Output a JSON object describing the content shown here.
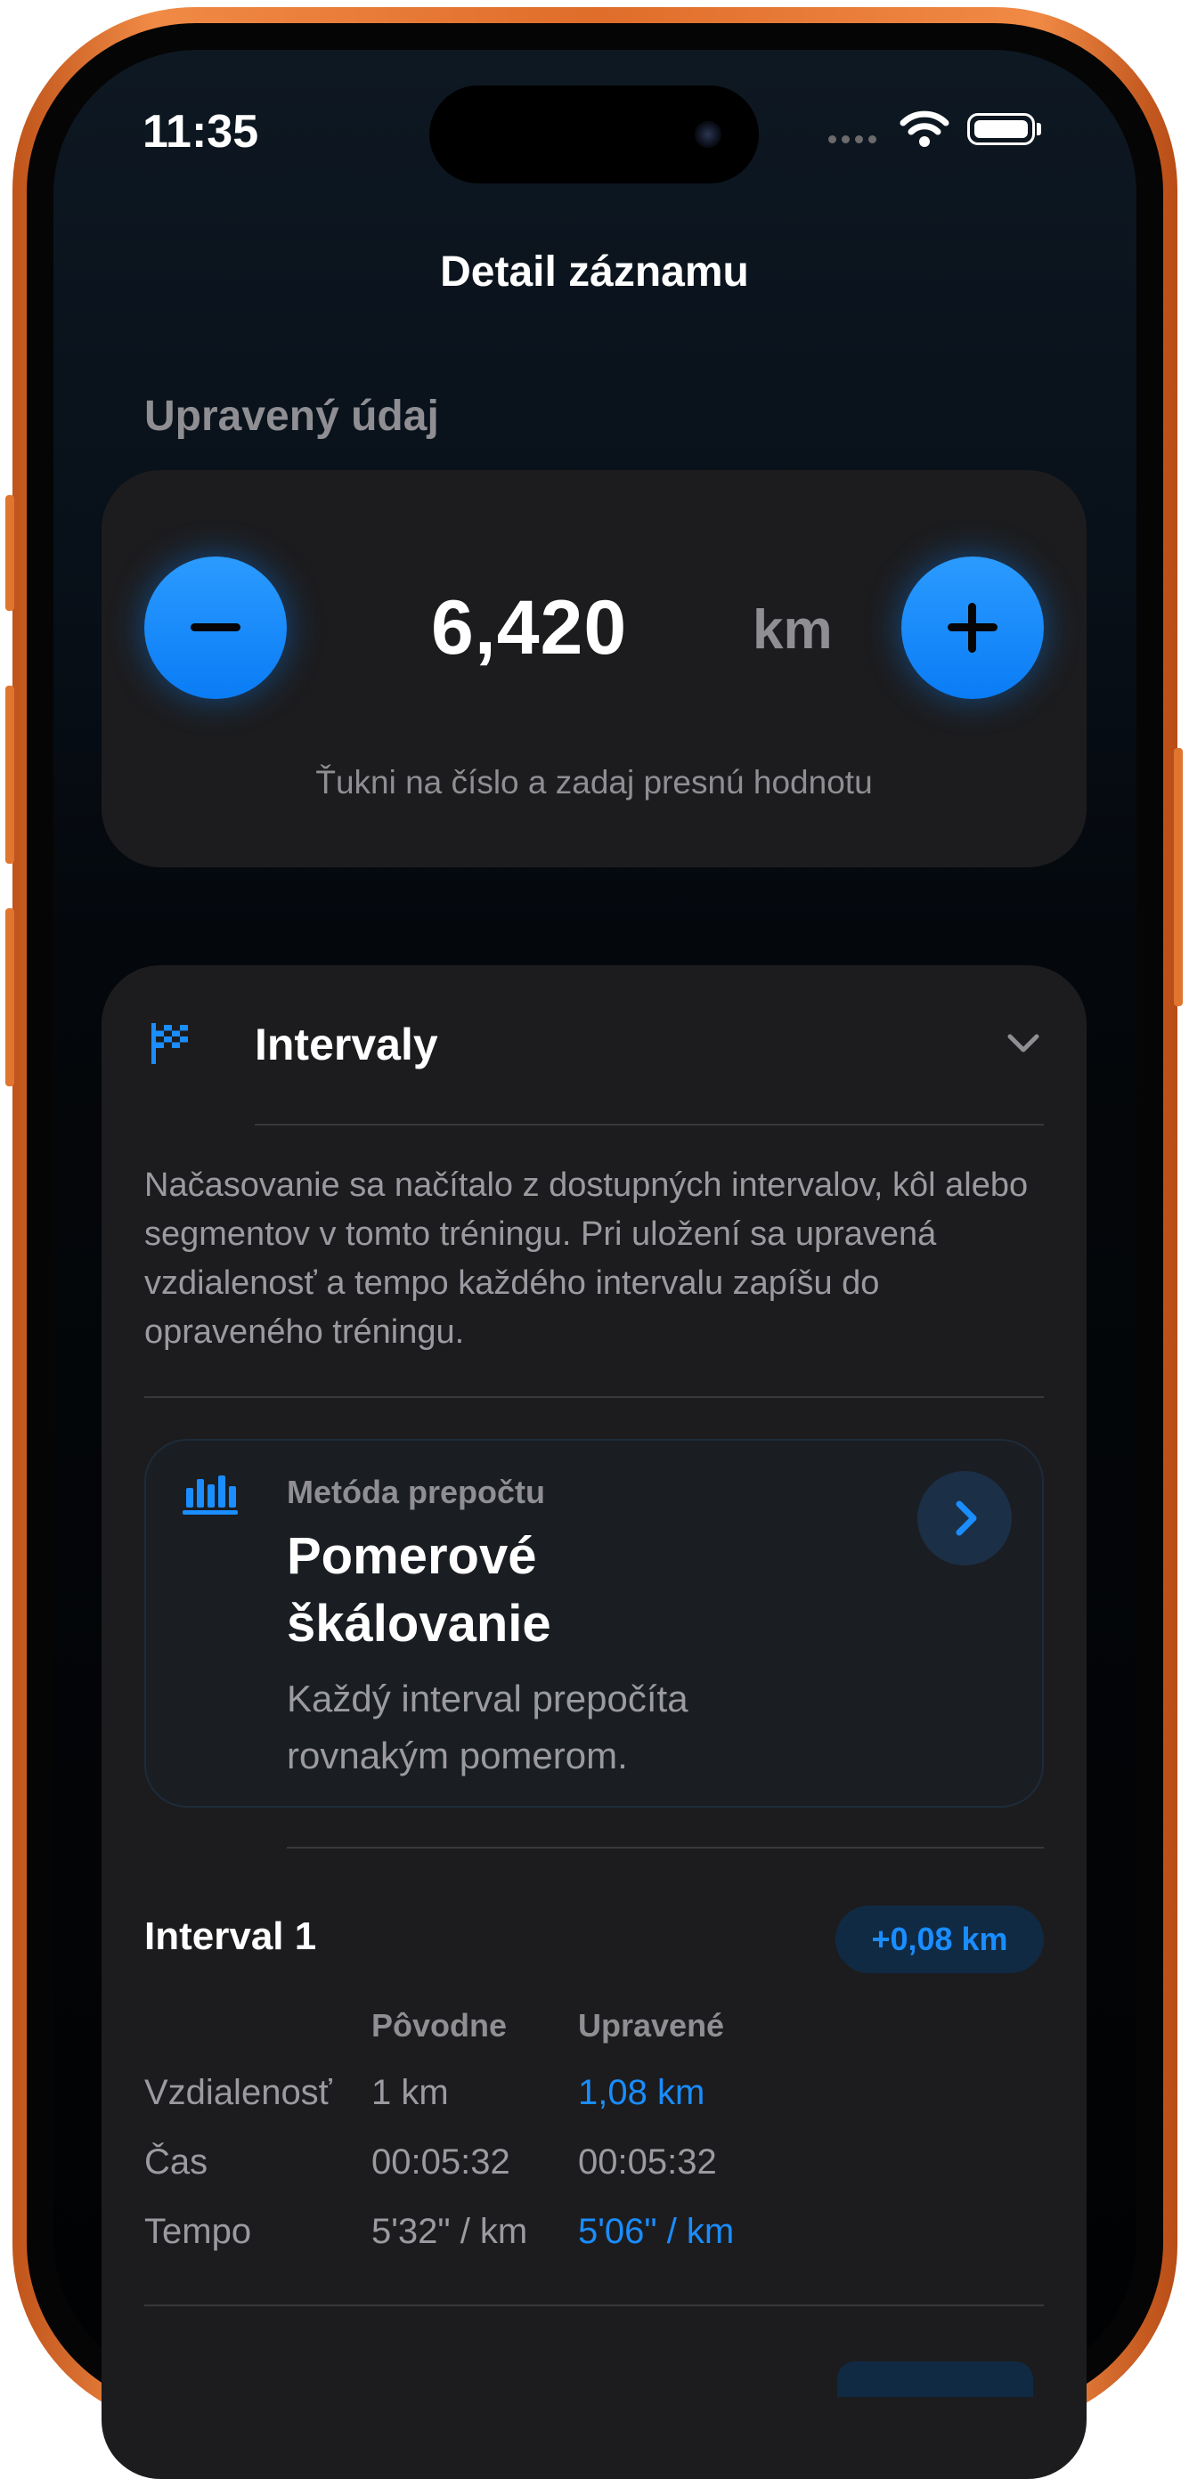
{
  "status_bar": {
    "time": "11:35"
  },
  "header": {
    "title": "Detail záznamu"
  },
  "adjusted": {
    "section_label": "Upravený údaj",
    "value": "6,420",
    "unit": "km",
    "hint": "Ťukni na číslo a zadaj presnú hodnotu"
  },
  "intervals": {
    "title": "Intervaly",
    "description": "Načasovanie sa načítalo z dostupných intervalov, kôl alebo segmentov v tomto tréningu. Pri uložení sa upravená vzdialenosť a tempo každého intervalu zapíšu do opraveného tréningu.",
    "method": {
      "label": "Metóda prepočtu",
      "title": "Pomerové škálovanie",
      "description": "Každý interval prepočíta rovnakým pomerom."
    },
    "interval_1": {
      "title": "Interval 1",
      "badge": "+0,08 km",
      "col_original": "Pôvodne",
      "col_adjusted": "Upravené",
      "rows": [
        {
          "label": "Vzdialenosť",
          "original": "1 km",
          "adjusted": "1,08 km"
        },
        {
          "label": "Čas",
          "original": "00:05:32",
          "adjusted": "00:05:32"
        },
        {
          "label": "Tempo",
          "original": "5'32\" / km",
          "adjusted": "5'06\" / km"
        }
      ]
    }
  },
  "colors": {
    "accent": "#0a84ff",
    "card": "#1c1c1e",
    "frame": "#e97a35"
  },
  "icons": [
    "minus-icon",
    "plus-icon",
    "checkered-flag-icon",
    "chevron-down-icon",
    "bar-chart-icon",
    "chevron-right-icon",
    "wifi-icon",
    "battery-icon"
  ]
}
